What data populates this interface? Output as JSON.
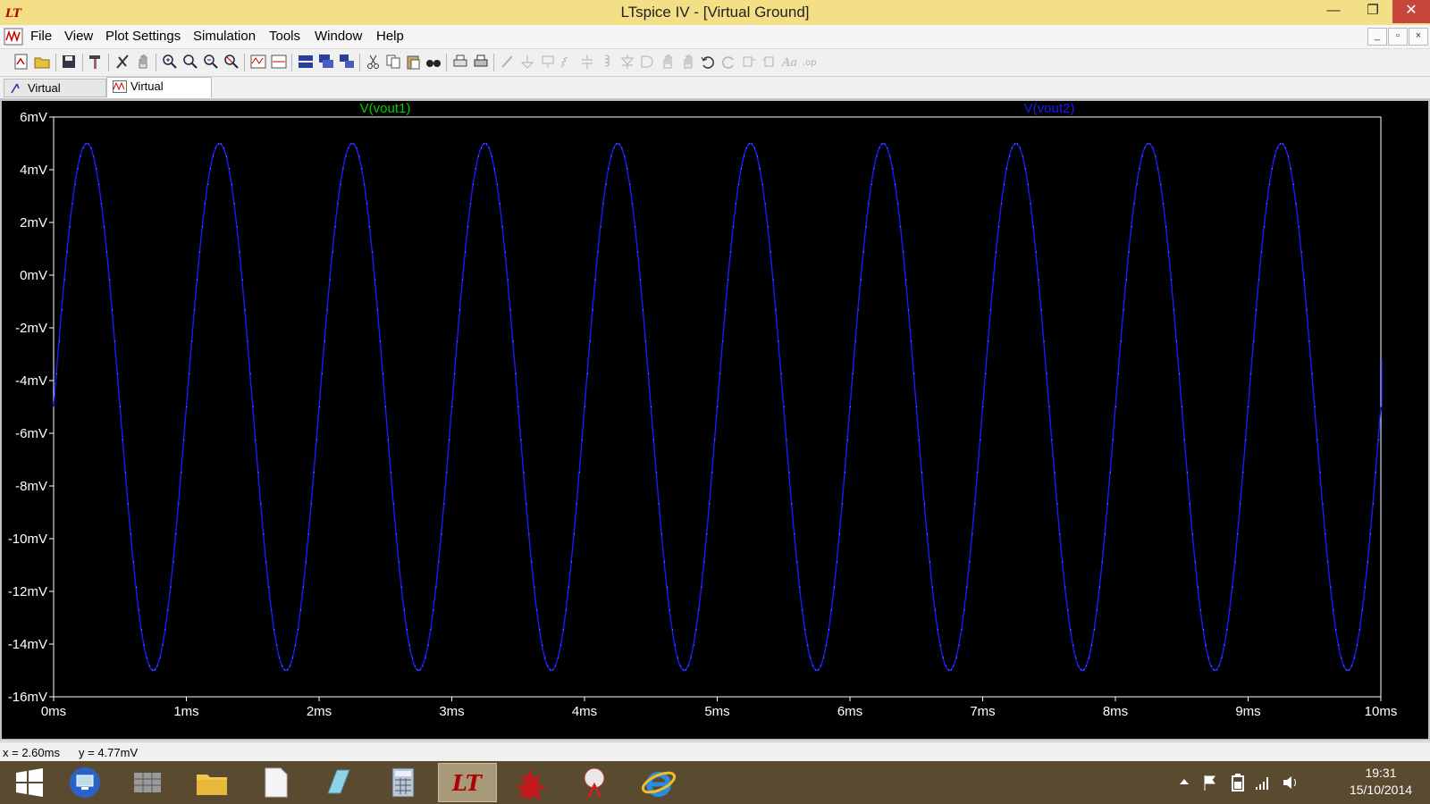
{
  "window": {
    "title": "LTspice IV - [Virtual Ground]",
    "minimize_glyph": "—",
    "restore_glyph": "❐",
    "close_glyph": "✕"
  },
  "menu": {
    "items": [
      "File",
      "View",
      "Plot Settings",
      "Simulation",
      "Tools",
      "Window",
      "Help"
    ],
    "mdi_minimize": "_",
    "mdi_restore": "▫",
    "mdi_close": "×"
  },
  "toolbar": {
    "icons": [
      "new-schematic",
      "open",
      "save",
      "control-panel",
      "run",
      "halt",
      "zoom-in",
      "zoom-area",
      "zoom-out",
      "zoom-full",
      "autorange",
      "plot-pane",
      "tile-horizontal",
      "tile-vertical",
      "cascade",
      "cut",
      "copy",
      "paste",
      "find",
      "print-setup",
      "print",
      "wire",
      "ground",
      "label-net",
      "resistor",
      "capacitor",
      "inductor",
      "diode",
      "component",
      "move",
      "drag",
      "undo",
      "redo",
      "rotate",
      "mirror",
      "text",
      "spice-directive"
    ]
  },
  "tabs": [
    {
      "label": "Virtual Ground",
      "icon": "schematic-icon",
      "active": false
    },
    {
      "label": "Virtual Ground",
      "icon": "waveform-icon",
      "active": true
    }
  ],
  "status": {
    "x_readout": "x = 2.60ms",
    "y_readout": "y = 4.77mV"
  },
  "chart_data": {
    "type": "line",
    "title": "",
    "xlabel": "",
    "ylabel": "",
    "x_unit": "ms",
    "y_unit": "mV",
    "xlim": [
      0,
      10
    ],
    "ylim": [
      -16,
      6
    ],
    "x_ticks": [
      "0ms",
      "1ms",
      "2ms",
      "3ms",
      "4ms",
      "5ms",
      "6ms",
      "7ms",
      "8ms",
      "9ms",
      "10ms"
    ],
    "y_ticks": [
      "6mV",
      "4mV",
      "2mV",
      "0mV",
      "-2mV",
      "-4mV",
      "-6mV",
      "-8mV",
      "-10mV",
      "-12mV",
      "-14mV",
      "-16mV"
    ],
    "background": "#000000",
    "grid": false,
    "series": [
      {
        "name": "V(vout1)",
        "color": "#00d000",
        "description_points": "coincident with V(vout2)"
      },
      {
        "name": "V(vout2)",
        "color": "#1a1aff",
        "function": "sine",
        "offset_mv": -5,
        "amplitude_mv": 10,
        "frequency_khz": 1,
        "start_x_ms": 0,
        "start_y_mv": -5,
        "peaks": [
          {
            "x": 0.25,
            "y": 5
          },
          {
            "x": 1.25,
            "y": 5
          },
          {
            "x": 2.25,
            "y": 5
          },
          {
            "x": 3.25,
            "y": 5
          },
          {
            "x": 4.25,
            "y": 5
          },
          {
            "x": 5.25,
            "y": 5
          },
          {
            "x": 6.25,
            "y": 5
          },
          {
            "x": 7.25,
            "y": 5
          },
          {
            "x": 8.25,
            "y": 5
          },
          {
            "x": 9.25,
            "y": 5
          }
        ],
        "troughs": [
          {
            "x": 0.75,
            "y": -15
          },
          {
            "x": 1.75,
            "y": -15
          },
          {
            "x": 2.75,
            "y": -15
          },
          {
            "x": 3.75,
            "y": -15
          },
          {
            "x": 4.75,
            "y": -15
          },
          {
            "x": 5.75,
            "y": -15
          },
          {
            "x": 6.75,
            "y": -15
          },
          {
            "x": 7.75,
            "y": -15
          },
          {
            "x": 8.75,
            "y": -15
          },
          {
            "x": 9.75,
            "y": -15
          }
        ]
      }
    ]
  },
  "taskbar": {
    "apps": [
      "start-icon",
      "remote-desktop-icon",
      "windows-explorer-grid-icon",
      "file-explorer-icon",
      "blank-document-icon",
      "notepad-icon",
      "calculator-icon",
      "ltspice-icon",
      "paint-splash-icon",
      "snipping-tool-icon",
      "internet-explorer-icon"
    ],
    "active_app": "ltspice-icon",
    "time": "19:31",
    "date": "15/10/2014"
  }
}
